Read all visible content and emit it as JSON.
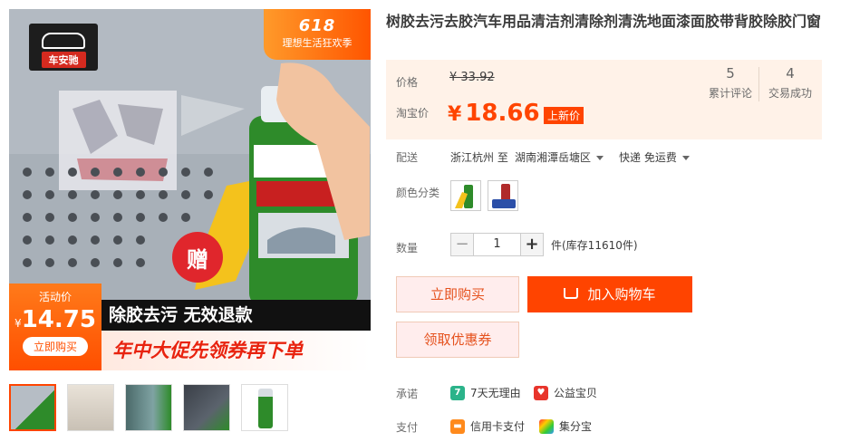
{
  "product": {
    "title": "树胶去污去胶汽车用品清洁剂清除剂清洗地面漆面胶带背胶除胶门窗"
  },
  "gallery": {
    "brand_name": "车安驰",
    "promo_618": "618",
    "promo_text": "理想生活狂欢季",
    "gift_text": "赠",
    "activity_label": "活动价",
    "activity_currency": "¥",
    "activity_price": "14.75",
    "activity_buy": "立即购买",
    "banner_line1": "除胶去污 无效退款",
    "banner_line2": "年中大促先领券再下单",
    "thumbnails": [
      "thumb-1",
      "thumb-2",
      "thumb-3",
      "thumb-4",
      "thumb-5"
    ]
  },
  "price": {
    "price_label": "价格",
    "original_price": "¥ 33.92",
    "taobao_label": "淘宝价",
    "currency": "¥",
    "current_price": "18.66",
    "new_tag": "上新价",
    "reviews_count": "5",
    "reviews_label": "累计评论",
    "deals_count": "4",
    "deals_label": "交易成功"
  },
  "shipping": {
    "label": "配送",
    "from": "浙江杭州 至",
    "to": "湖南湘潭岳塘区",
    "method": "快递 免运费"
  },
  "sku": {
    "label": "颜色分类"
  },
  "quantity": {
    "label": "数量",
    "minus": "−",
    "value": "1",
    "plus": "+",
    "stock": "件(库存11610件)"
  },
  "actions": {
    "buy_now": "立即购买",
    "add_cart": "加入购物车",
    "coupon": "领取优惠券"
  },
  "services": {
    "promise_label": "承诺",
    "promise_1_icon": "7",
    "promise_1": "7天无理由",
    "promise_2": "公益宝贝",
    "pay_label": "支付",
    "pay_1": "信用卡支付",
    "pay_2": "集分宝"
  },
  "colors": {
    "accent": "#ff4400",
    "price_bg": "#fff2e8"
  }
}
